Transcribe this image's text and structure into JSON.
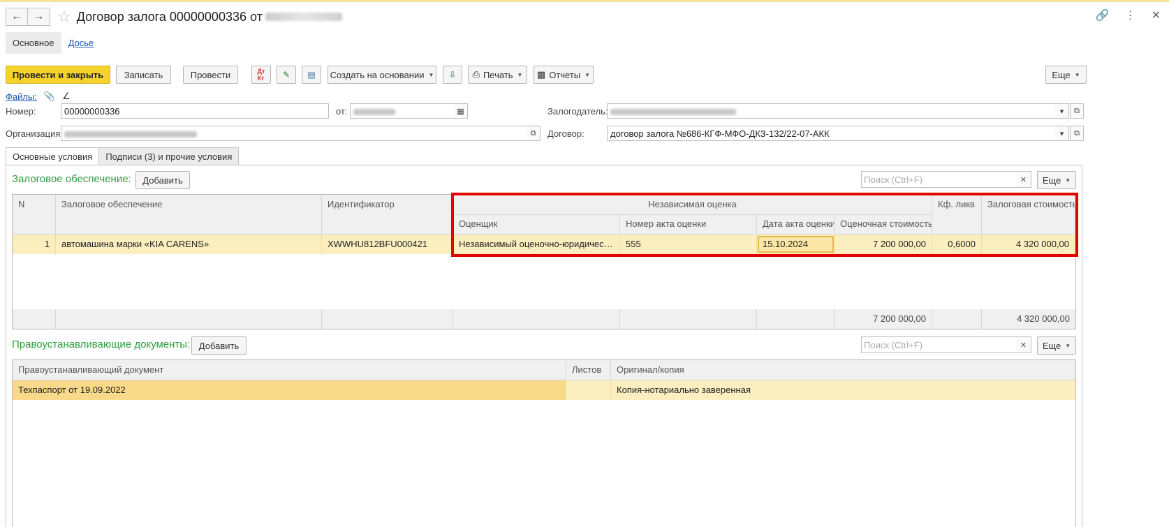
{
  "window": {
    "title": "Договор залога 00000000336 от",
    "back_icon": "arrow-left-icon",
    "forward_icon": "arrow-right-icon"
  },
  "sections": {
    "main": "Основное",
    "dossier": "Досье"
  },
  "toolbar": {
    "post_close": "Провести и закрыть",
    "save": "Записать",
    "post": "Провести",
    "create_based": "Создать на основании",
    "print": "Печать",
    "reports": "Отчеты",
    "more": "Еще"
  },
  "files_label": "Файлы:",
  "header": {
    "number_label": "Номер:",
    "number_value": "00000000336",
    "date_label": "от:",
    "org_label": "Организация:",
    "pledgor_label": "Залогодатель:",
    "contract_label": "Договор:",
    "contract_value": "договор залога №686-КГФ-МФО-ДКЗ-132/22-07-АКК"
  },
  "tabs": [
    "Основные условия",
    "Подписи (3) и прочие условия"
  ],
  "collateral": {
    "title": "Залоговое обеспечение:",
    "add_button": "Добавить",
    "search_placeholder": "Поиск (Ctrl+F)",
    "more": "Еще",
    "columns": {
      "n": "N",
      "collateral": "Залоговое обеспечение",
      "identifier": "Идентификатор",
      "independent_valuation": "Независимая оценка",
      "appraiser": "Оценщик",
      "act_number": "Номер акта оценки",
      "act_date": "Дата акта оценки",
      "valuation": "Оценочная стоимость",
      "liquidity": "Кф. ликв",
      "pledge_value": "Залоговая стоимость"
    },
    "rows": [
      {
        "n": "1",
        "collateral": "автомашина марки «KIA CARENS»",
        "identifier": "XWWHU812BFU000421",
        "appraiser": "Независимый оценочно-юридически…",
        "act_number": "555",
        "act_date": "15.10.2024",
        "valuation": "7 200 000,00",
        "liquidity": "0,6000",
        "pledge_value": "4 320 000,00"
      }
    ],
    "totals": {
      "valuation": "7 200 000,00",
      "pledge_value": "4 320 000,00"
    }
  },
  "title_docs": {
    "title": "Правоустанавливающие документы:",
    "add_button": "Добавить",
    "search_placeholder": "Поиск (Ctrl+F)",
    "more": "Еще",
    "columns": {
      "document": "Правоустанавливающий документ",
      "sheets": "Листов",
      "original": "Оригинал/копия"
    },
    "rows": [
      {
        "document": "Техпаспорт от 19.09.2022",
        "sheets": "",
        "original": "Копия-нотариально заверенная"
      }
    ]
  }
}
